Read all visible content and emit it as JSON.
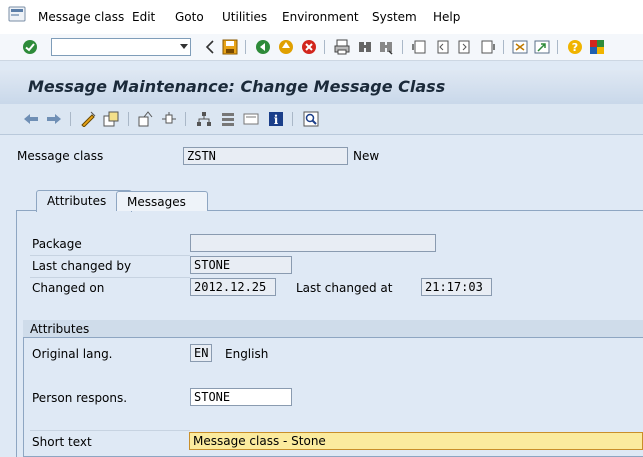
{
  "menubar": {
    "items": [
      "Message class",
      "Edit",
      "Goto",
      "Utilities",
      "Environment",
      "System",
      "Help"
    ]
  },
  "toolbar": {
    "command_field_value": ""
  },
  "page": {
    "title": "Message Maintenance: Change Message Class"
  },
  "header": {
    "message_class_label": "Message class",
    "message_class_value": "ZSTN",
    "status_text": "New"
  },
  "tabs": [
    {
      "label": "Attributes",
      "selected": true
    },
    {
      "label": "Messages",
      "selected": false
    }
  ],
  "attributes": {
    "package_label": "Package",
    "package_value": "",
    "last_changed_by_label": "Last changed by",
    "last_changed_by_value": "STONE",
    "changed_on_label": "Changed on",
    "changed_on_value": "2012.12.25",
    "last_changed_at_label": "Last changed at",
    "last_changed_at_value": "21:17:03"
  },
  "attributes_group": {
    "title": "Attributes",
    "original_lang_label": "Original lang.",
    "original_lang_value": "EN",
    "original_lang_text": "English",
    "person_respons_label": "Person respons.",
    "person_respons_value": "STONE",
    "short_text_label": "Short text",
    "short_text_value": "Message class - Stone"
  },
  "colors": {
    "background": "#dfe9f5",
    "title_band": "#c9d8ea",
    "active_field": "#fbeb9e"
  }
}
